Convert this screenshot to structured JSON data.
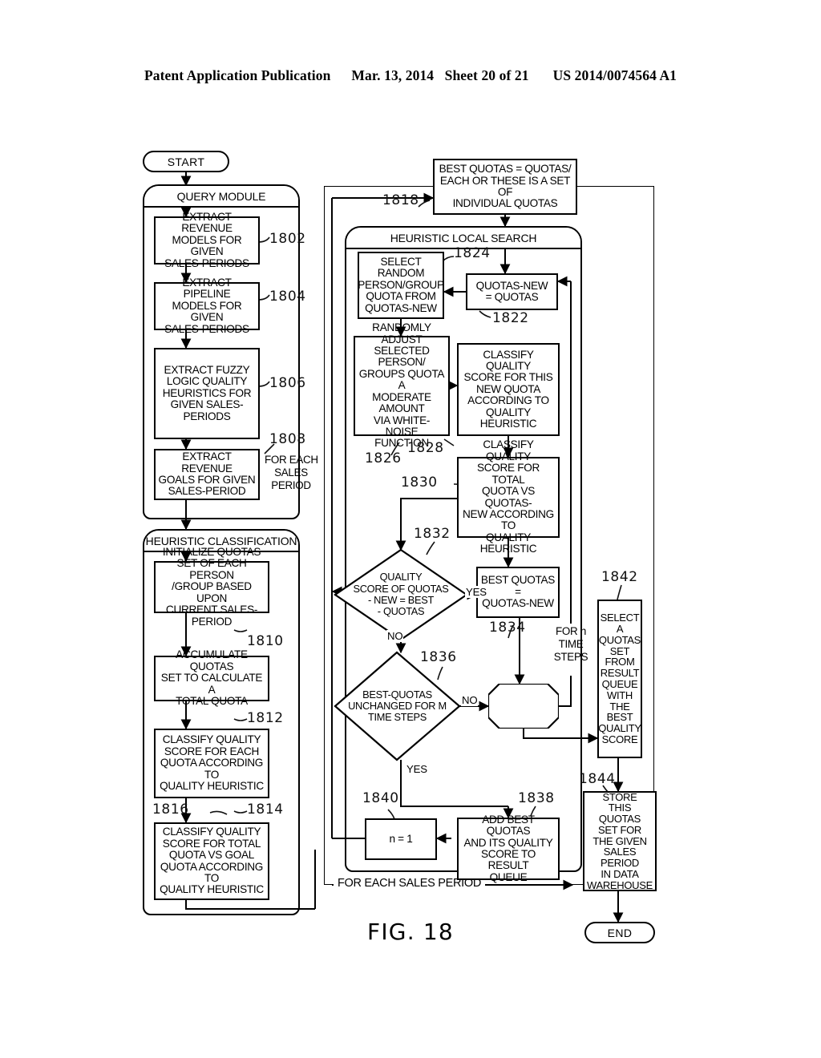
{
  "header": {
    "publication": "Patent Application Publication",
    "date": "Mar. 13, 2014",
    "sheet": "Sheet 20 of 21",
    "patent_number": "US 2014/0074564 A1"
  },
  "figure": {
    "caption": "FIG. 18",
    "start_label": "START",
    "end_label": "END"
  },
  "groups": {
    "query_module": "QUERY MODULE",
    "heuristic_classification": "HEURISTIC CLASSIFICATION",
    "heuristic_local_search": "HEURISTIC LOCAL SEARCH",
    "for_each_sales_period": "FOR EACH SALES PERIOD"
  },
  "nodes": {
    "n1802": "EXTRACT REVENUE MODELS FOR GIVEN SALES-PERIODS",
    "n1804": "EXTRACT PIPELINE MODELS FOR GIVEN SALES-PERIODS",
    "n1806": "EXTRACT FUZZY LOGIC QUALITY HEURISTICS FOR GIVEN SALES-PERIODS",
    "n1808": "EXTRACT REVENUE GOALS FOR GIVEN SALES-PERIOD",
    "n1810": "INITIALIZE QUOTAS SET OF EACH PERSON /GROUP BASED UPON CURRENT SALES-PERIOD",
    "n1812": "ACCUMULATE QUOTAS SET TO CALCULATE A TOTAL QUOTA",
    "n1814": "CLASSIFY QUALITY SCORE FOR EACH QUOTA ACCORDING TO QUALITY HEURISTIC",
    "n1816": "CLASSIFY QUALITY SCORE FOR TOTAL QUOTA VS GOAL QUOTA ACCORDING TO QUALITY HEURISTIC",
    "n1818": "BEST QUOTAS = QUOTAS/ EACH OR THESE IS A SET OF INDIVIDUAL QUOTAS",
    "n1822": "QUOTAS-NEW = QUOTAS",
    "n1824": "SELECT RANDOM PERSON/GROUP QUOTA FROM QUOTAS-NEW",
    "n1826": "RANDOMLY ADJUST SELECTED PERSON/ GROUPS QUOTA A MODERATE AMOUNT VIA WHITE-NOISE FUNCTION",
    "n1828": "CLASSIFY QUALITY SCORE FOR THIS NEW QUOTA ACCORDING TO QUALITY HEURISTIC",
    "n1830": "CLASSIFY QUALITY SCORE FOR TOTAL QUOTA VS QUOTAS-NEW ACCORDING TO QUALITY HEURISTIC",
    "n1832": "QUALITY SCORE OF QUOTAS - NEW = BEST - QUOTAS",
    "n1834": "BEST QUOTAS = QUOTAS-NEW",
    "n1836": "BEST-QUOTAS UNCHANGED FOR M TIME STEPS",
    "n1838": "ADD BEST QUOTAS AND ITS QUALITY SCORE TO RESULT QUEUE",
    "n1840": "n = 1",
    "n1842": "SELECT A QUOTAS SET FROM RESULT QUEUE WITH THE BEST QUALITY SCORE",
    "n1844": "STORE THIS QUOTAS SET FOR THE GIVEN SALES PERIOD IN DATA WAREHOUSE"
  },
  "node_lines": {
    "n1802": [
      "EXTRACT REVENUE",
      "MODELS FOR GIVEN",
      "SALES-PERIODS"
    ],
    "n1804": [
      "EXTRACT PIPELINE",
      "MODELS FOR GIVEN",
      "SALES-PERIODS"
    ],
    "n1806": [
      "EXTRACT FUZZY",
      "LOGIC QUALITY",
      "HEURISTICS FOR",
      "GIVEN SALES-",
      "PERIODS"
    ],
    "n1808": [
      "EXTRACT REVENUE",
      "GOALS FOR GIVEN",
      "SALES-PERIOD"
    ],
    "n1810": [
      "INITIALIZE QUOTAS",
      "SET OF EACH PERSON",
      "/GROUP BASED UPON",
      "CURRENT SALES-PERIOD"
    ],
    "n1812": [
      "ACCUMULATE QUOTAS",
      "SET TO CALCULATE A",
      "TOTAL QUOTA"
    ],
    "n1814": [
      "CLASSIFY QUALITY",
      "SCORE FOR EACH",
      "QUOTA ACCORDING TO",
      "QUALITY HEURISTIC"
    ],
    "n1816": [
      "CLASSIFY QUALITY",
      "SCORE FOR TOTAL",
      "QUOTA VS GOAL",
      "QUOTA ACCORDING TO",
      "QUALITY HEURISTIC"
    ],
    "n1818": [
      "BEST QUOTAS = QUOTAS/",
      "EACH OR THESE IS A SET OF",
      "INDIVIDUAL QUOTAS"
    ],
    "n1822": [
      "QUOTAS-NEW",
      "= QUOTAS"
    ],
    "n1824": [
      "SELECT RANDOM",
      "PERSON/GROUP",
      "QUOTA FROM",
      "QUOTAS-NEW"
    ],
    "n1826": [
      "RANDOMLY ADJUST",
      "SELECTED PERSON/",
      "GROUPS QUOTA A",
      "MODERATE AMOUNT",
      "VIA WHITE-NOISE",
      "FUNCTION"
    ],
    "n1828": [
      "CLASSIFY QUALITY",
      "SCORE FOR THIS",
      "NEW QUOTA",
      "ACCORDING TO",
      "QUALITY HEURISTIC"
    ],
    "n1830": [
      "CLASSIFY QUALITY",
      "SCORE FOR TOTAL",
      "QUOTA VS QUOTAS-",
      "NEW ACCORDING TO",
      "QUALITY HEURISTIC"
    ],
    "n1832": [
      "QUALITY",
      "SCORE OF QUOTAS",
      "- NEW = BEST",
      "- QUOTAS"
    ],
    "n1834": [
      "BEST QUOTAS =",
      "QUOTAS-NEW"
    ],
    "n1836": [
      "BEST-QUOTAS",
      "UNCHANGED FOR M",
      "TIME STEPS"
    ],
    "n1838": [
      "ADD BEST QUOTAS",
      "AND ITS QUALITY",
      "SCORE TO RESULT",
      "QUEUE"
    ],
    "n1840": [
      "n = 1"
    ],
    "n1842": [
      "SELECT",
      "A QUOTAS",
      "SET FROM",
      "RESULT",
      "QUEUE",
      "WITH THE",
      "BEST",
      "QUALITY",
      "SCORE"
    ],
    "n1844": [
      "STORE",
      "THIS QUOTAS",
      "SET FOR",
      "THE GIVEN",
      "SALES PERIOD",
      "IN DATA",
      "WAREHOUSE"
    ]
  },
  "reference_numerals": {
    "r1802": "1802",
    "r1804": "1804",
    "r1806": "1806",
    "r1808": "1808",
    "r1810": "1810",
    "r1812": "1812",
    "r1814": "1814",
    "r1816": "1816",
    "r1818": "1818",
    "r1822": "1822",
    "r1824": "1824",
    "r1826": "1826",
    "r1828": "1828",
    "r1830": "1830",
    "r1832": "1832",
    "r1834": "1834",
    "r1836": "1836",
    "r1838": "1838",
    "r1840": "1840",
    "r1842": "1842",
    "r1844": "1844"
  },
  "edge_labels": {
    "yes_1832": "YES",
    "no_1832": "NO",
    "no_1836": "NO",
    "yes_1836": "YES"
  },
  "annotations": {
    "for_each_sales_period_side": [
      "FOR EACH",
      "SALES",
      "PERIOD"
    ],
    "for_n_time_steps": [
      "FOR n",
      "TIME",
      "STEPS"
    ]
  }
}
